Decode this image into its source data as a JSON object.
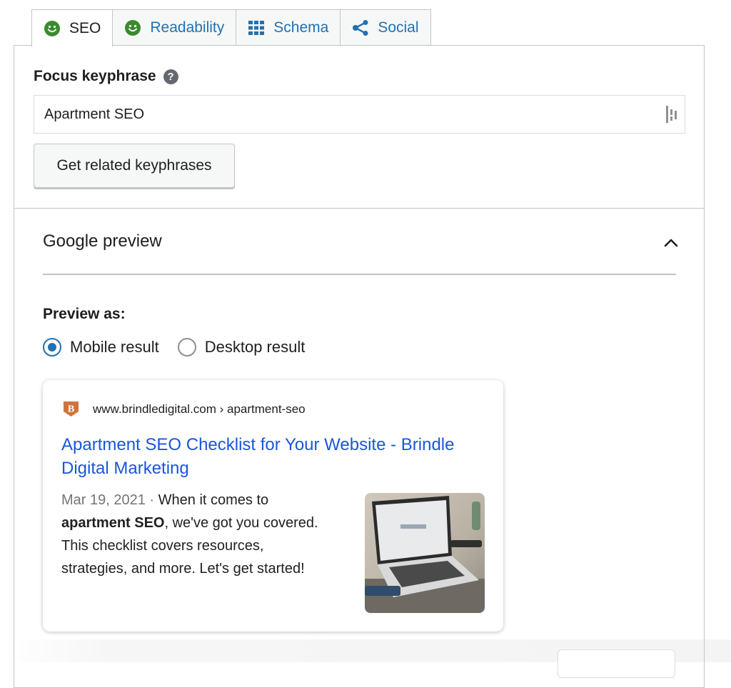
{
  "tabs": [
    {
      "label": "SEO",
      "icon": "smiley-icon",
      "active": true
    },
    {
      "label": "Readability",
      "icon": "smiley-icon",
      "active": false
    },
    {
      "label": "Schema",
      "icon": "grid-icon",
      "active": false
    },
    {
      "label": "Social",
      "icon": "share-icon",
      "active": false
    }
  ],
  "focus": {
    "label": "Focus keyphrase",
    "help_symbol": "?",
    "value": "Apartment SEO",
    "related_button": "Get related keyphrases"
  },
  "google_preview": {
    "title": "Google preview",
    "preview_as": "Preview as:",
    "options": [
      "Mobile result",
      "Desktop result"
    ],
    "selected": "Mobile result"
  },
  "serp": {
    "favicon_letter": "B",
    "url": "www.brindledigital.com › apartment-seo",
    "title": "Apartment SEO Checklist for Your Website - Brindle Digital Marketing",
    "date": "Mar 19, 2021",
    "separator": "·",
    "desc_pre": "When it comes to",
    "desc_bold": "apartment SEO",
    "desc_post": ", we've got you covered. This checklist covers resources, strategies, and more. Let's get started!"
  },
  "colors": {
    "accent": "#2271b1",
    "smiley_green": "#3a8b2e",
    "serp_link": "#1a56db",
    "favicon_orange": "#d0733c"
  }
}
